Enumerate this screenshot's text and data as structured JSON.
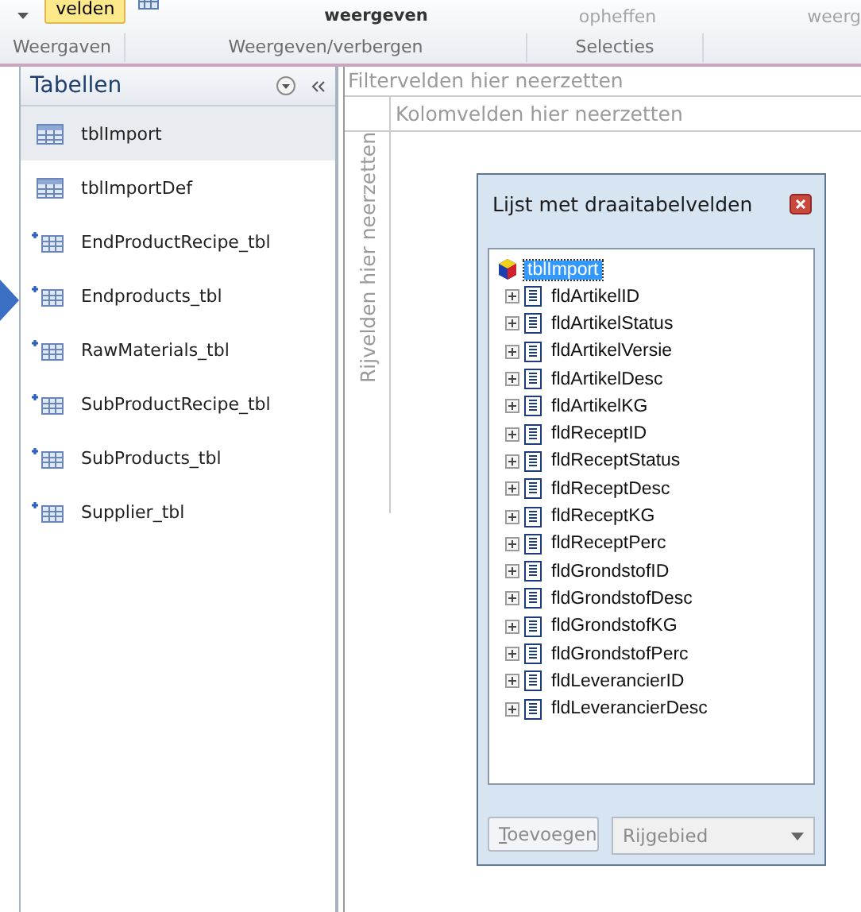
{
  "ribbon": {
    "controls": [
      {
        "label": "velden",
        "kind": "highlighted"
      },
      {
        "label": "weergeven",
        "kind": "plain"
      },
      {
        "label": "opheffen",
        "kind": "disabled"
      },
      {
        "label": "weerg",
        "kind": "disabled"
      }
    ],
    "groups": [
      "Weergaven",
      "Weergeven/verbergen",
      "Selecties"
    ]
  },
  "navigation": {
    "title": "Tabellen",
    "items": [
      {
        "label": "tblImport",
        "kind": "local",
        "selected": true
      },
      {
        "label": "tblImportDef",
        "kind": "local",
        "selected": false
      },
      {
        "label": "EndProductRecipe_tbl",
        "kind": "linked",
        "selected": false
      },
      {
        "label": "Endproducts_tbl",
        "kind": "linked",
        "selected": false
      },
      {
        "label": "RawMaterials_tbl",
        "kind": "linked",
        "selected": false
      },
      {
        "label": "SubProductRecipe_tbl",
        "kind": "linked",
        "selected": false
      },
      {
        "label": "SubProducts_tbl",
        "kind": "linked",
        "selected": false
      },
      {
        "label": "Supplier_tbl",
        "kind": "linked",
        "selected": false
      }
    ]
  },
  "pivot": {
    "filter_zone": "Filtervelden hier neerzetten",
    "column_zone": "Kolomvelden hier neerzetten",
    "row_zone": "Rijvelden hier neerzetten"
  },
  "field_list": {
    "title": "Lijst met draaitabelvelden",
    "root": {
      "label": "tblImport",
      "selected": true,
      "children": [
        {
          "label": "fldArtikelID"
        },
        {
          "label": "fldArtikelStatus"
        },
        {
          "label": "fldArtikelVersie"
        },
        {
          "label": "fldArtikelDesc"
        },
        {
          "label": "fldArtikelKG"
        },
        {
          "label": "fldReceptID"
        },
        {
          "label": "fldReceptStatus"
        },
        {
          "label": "fldReceptDesc"
        },
        {
          "label": "fldReceptKG"
        },
        {
          "label": "fldReceptPerc"
        },
        {
          "label": "fldGrondstofID"
        },
        {
          "label": "fldGrondstofDesc"
        },
        {
          "label": "fldGrondstofKG"
        },
        {
          "label": "fldGrondstofPerc"
        },
        {
          "label": "fldLeverancierID"
        },
        {
          "label": "fldLeverancierDesc"
        }
      ]
    },
    "add_button": {
      "label": "Toevoegen",
      "disabled": true
    },
    "area_dropdown": {
      "value": "Rijgebied",
      "disabled": true
    }
  }
}
